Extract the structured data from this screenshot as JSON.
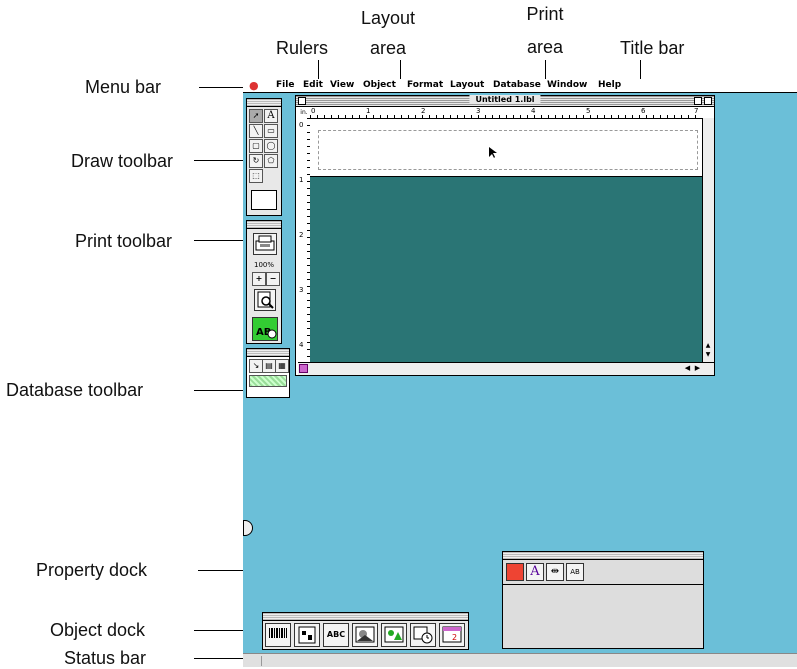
{
  "callouts": {
    "rulers": "Rulers",
    "layout_area_1": "Layout",
    "layout_area_2": "area",
    "print_area_1": "Print",
    "print_area_2": "area",
    "title_bar": "Title bar",
    "menu_bar": "Menu bar",
    "draw_toolbar": "Draw toolbar",
    "print_toolbar": "Print toolbar",
    "database_toolbar": "Database toolbar",
    "property_dock": "Property dock",
    "object_dock": "Object dock",
    "status_bar": "Status bar"
  },
  "menu": {
    "items": [
      "File",
      "Edit",
      "View",
      "Object",
      "Format",
      "Layout",
      "Database",
      "Window",
      "Help"
    ]
  },
  "window": {
    "title": "Untitled 1.lbl",
    "ruler_unit": "in.",
    "ruler_h_numbers": [
      "0",
      "1",
      "2",
      "3",
      "4",
      "5",
      "6",
      "7"
    ],
    "ruler_v_numbers": [
      "0",
      "1",
      "2",
      "3",
      "4"
    ]
  },
  "print_toolbar": {
    "zoom": "100%"
  },
  "colors": {
    "desktop": "#6bbfd8",
    "layout_area": "#2a7575"
  }
}
